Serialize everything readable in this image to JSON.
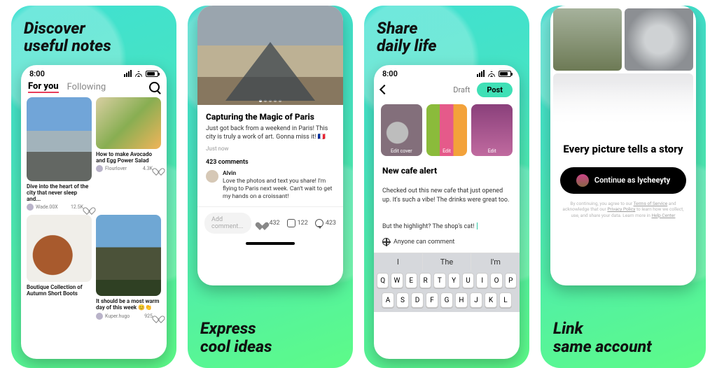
{
  "panels": {
    "discover": {
      "headline": "Discover\nuseful notes"
    },
    "express": {
      "footline": "Express\ncool ideas"
    },
    "share": {
      "headline": "Share\ndaily life"
    },
    "link": {
      "footline": "Link\nsame account"
    }
  },
  "status": {
    "time": "8:00"
  },
  "feed": {
    "tabs": {
      "foryou": "For you",
      "following": "Following"
    },
    "cards": [
      {
        "caption": "Dive into the heart of the city that never sleep and...",
        "user": "Wade.00X",
        "likes": "12.5K"
      },
      {
        "caption": "How to make Avocado and Egg Power Salad",
        "user": "Flourlover",
        "likes": "4.3K"
      },
      {
        "caption": "It should be a most warm day of this week 😊👏",
        "user": "Kuper.hugo",
        "likes": "925"
      },
      {
        "caption": "Boutique Collection of Autumn Short Boots"
      }
    ]
  },
  "post": {
    "title": "Capturing the Magic of Paris",
    "body": "Just got back from a weekend in Paris! This city is truly a work of art. Gonna miss it! 🇫🇷",
    "time": "Just now",
    "comments_header": "423 comments",
    "comment": {
      "name": "Alvin",
      "text": "Love the photos and text you share! I'm flying to Paris next week. Can't wait to get my hands on a croissant!"
    },
    "add_placeholder": "Add comment...",
    "counts": {
      "likes": "432",
      "saves": "122",
      "comments": "423"
    }
  },
  "compose": {
    "draft": "Draft",
    "post": "Post",
    "media_labels": {
      "cover": "Edit cover",
      "edit": "Edit"
    },
    "title": "New cafe alert",
    "body_line1": "Checked out this new cafe that just opened up. It's such a vibe! The drinks were great too.",
    "body_line2": "But the highlight? The shop's cat! ",
    "permission": "Anyone can comment",
    "predict": [
      "I",
      "The",
      "I'm"
    ],
    "rows": [
      [
        "Q",
        "W",
        "E",
        "R",
        "T",
        "Y",
        "U",
        "I",
        "O",
        "P"
      ],
      [
        "A",
        "S",
        "D",
        "F",
        "G",
        "H",
        "J",
        "K",
        "L"
      ]
    ]
  },
  "onboard": {
    "title": "Every picture tells a story",
    "cta_prefix": "Continue as ",
    "cta_user": "lycheeyty",
    "legal_1": "By continuing, you agree to our ",
    "legal_terms": "Terms of Service",
    "legal_2": " and acknowledge that our ",
    "legal_privacy": "Privacy Policy",
    "legal_3": " to learn how we collect, use, and share your data. Learn more in ",
    "legal_help": "Help Center"
  }
}
